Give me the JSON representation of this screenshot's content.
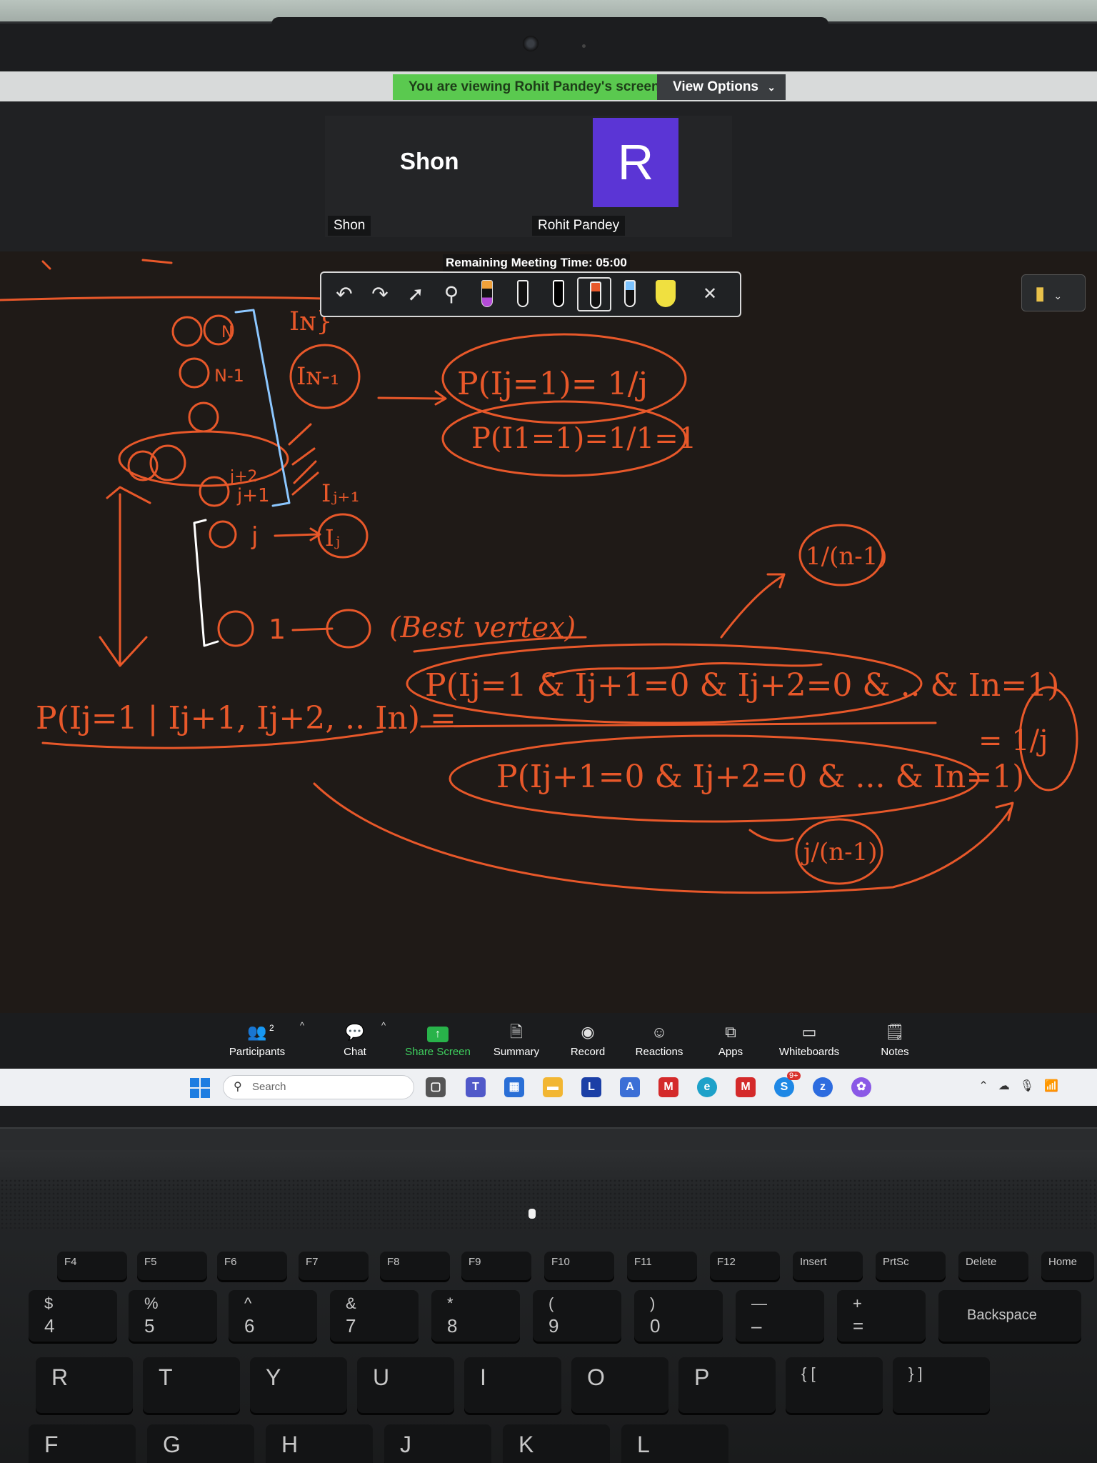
{
  "share_banner": {
    "text": "You are viewing Rohit Pandey's screen",
    "view_options_label": "View Options",
    "banner_color": "#5ac94f"
  },
  "participants_strip": {
    "tiles": [
      {
        "display_text": "Shon",
        "name_label": "Shon"
      },
      {
        "avatar_letter": "R",
        "name_label": "Rohit Pandey",
        "avatar_color": "#5b35d5"
      }
    ]
  },
  "whiteboard": {
    "remaining_time": "Remaining Meeting Time: 05:00",
    "toolbar": {
      "tools": [
        "undo-icon",
        "redo-icon",
        "select-pointer-icon",
        "search-icon",
        "marker-purple-icon",
        "pen-white-icon",
        "pen-black-icon",
        "pen-orange-icon",
        "pen-blue-icon",
        "highlighter-yellow-icon",
        "close-icon"
      ],
      "selected_tool": "pen-orange-icon"
    },
    "ink_color": "#e8582a",
    "annotations": {
      "top_right_labels": [
        "I",
        "N",
        "}"
      ],
      "node_labels": [
        "N",
        "N-1",
        "j+2",
        "j+1",
        "j",
        "1"
      ],
      "indicator_labels": [
        "I",
        "N-1",
        "j+1",
        "j"
      ],
      "best_vertex_label": "(Best vertex)",
      "prob_1": "P(Ij=1)= 1/j",
      "prob_2": "P(I1=1)=1/1=1",
      "numerator": "P(Ij=1 & Ij+1=0 & Ij+2=0 & .. & In=1)",
      "denominator": "P(Ij+1=0 & Ij+2=0 & ... & In=1)",
      "lhs": "P(Ij=1 | Ij+1, Ij+2, .. In) =",
      "frac_1_over_n_minus_1": "1/(n-1)",
      "frac_j_over_n_minus_1": "j/(n-1)",
      "result": "= 1/j"
    }
  },
  "zoom_controls": [
    {
      "label": "Participants",
      "icon": "participants-icon",
      "badge": "2"
    },
    {
      "label": "Chat",
      "icon": "chat-icon"
    },
    {
      "label": "Share Screen",
      "icon": "share-screen-icon"
    },
    {
      "label": "Summary",
      "icon": "summary-icon"
    },
    {
      "label": "Record",
      "icon": "record-icon"
    },
    {
      "label": "Reactions",
      "icon": "reactions-icon"
    },
    {
      "label": "Apps",
      "icon": "apps-icon"
    },
    {
      "label": "Whiteboards",
      "icon": "whiteboards-icon"
    },
    {
      "label": "Notes",
      "icon": "notes-icon"
    }
  ],
  "taskbar": {
    "search_placeholder": "Search",
    "notification_badge": "9+"
  },
  "keyboard": {
    "fn_row": [
      {
        "top": "F4"
      },
      {
        "top": "F5"
      },
      {
        "top": "F6"
      },
      {
        "top": "F7"
      },
      {
        "top": "F8"
      },
      {
        "top": "F9"
      },
      {
        "top": "F10"
      },
      {
        "top": "F11"
      },
      {
        "top": "F12"
      },
      {
        "top": "Insert"
      },
      {
        "top": "PrtSc"
      },
      {
        "top": "Delete"
      },
      {
        "top": "Home"
      }
    ],
    "num_row": [
      {
        "top": "$",
        "bot": "4"
      },
      {
        "top": "%",
        "bot": "5"
      },
      {
        "top": "^",
        "bot": "6"
      },
      {
        "top": "&",
        "bot": "7"
      },
      {
        "top": "*",
        "bot": "8"
      },
      {
        "top": "(",
        "bot": "9"
      },
      {
        "top": ")",
        "bot": "0"
      },
      {
        "top": "—",
        "bot": "–"
      },
      {
        "top": "+",
        "bot": "="
      }
    ],
    "backspace_label": "Backspace",
    "letter_row": [
      "R",
      "T",
      "Y",
      "U",
      "I",
      "O",
      "P",
      "{ [",
      "} ]"
    ],
    "bottom_row": [
      "F",
      "G",
      "H",
      "J",
      "K",
      "L"
    ]
  }
}
